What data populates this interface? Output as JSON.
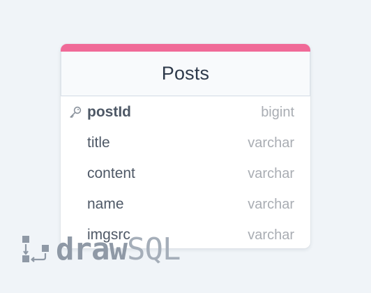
{
  "table": {
    "title": "Posts",
    "accent_color": "#f06a98",
    "columns": [
      {
        "name": "postId",
        "type": "bigint",
        "primary_key": true,
        "icon": "key-icon"
      },
      {
        "name": "title",
        "type": "varchar",
        "primary_key": false
      },
      {
        "name": "content",
        "type": "varchar",
        "primary_key": false
      },
      {
        "name": "name",
        "type": "varchar",
        "primary_key": false
      },
      {
        "name": "imgsrc",
        "type": "varchar",
        "primary_key": false
      }
    ]
  },
  "watermark": {
    "draw": "draw",
    "sql": "SQL",
    "icon": "drawsql-logo-icon"
  }
}
